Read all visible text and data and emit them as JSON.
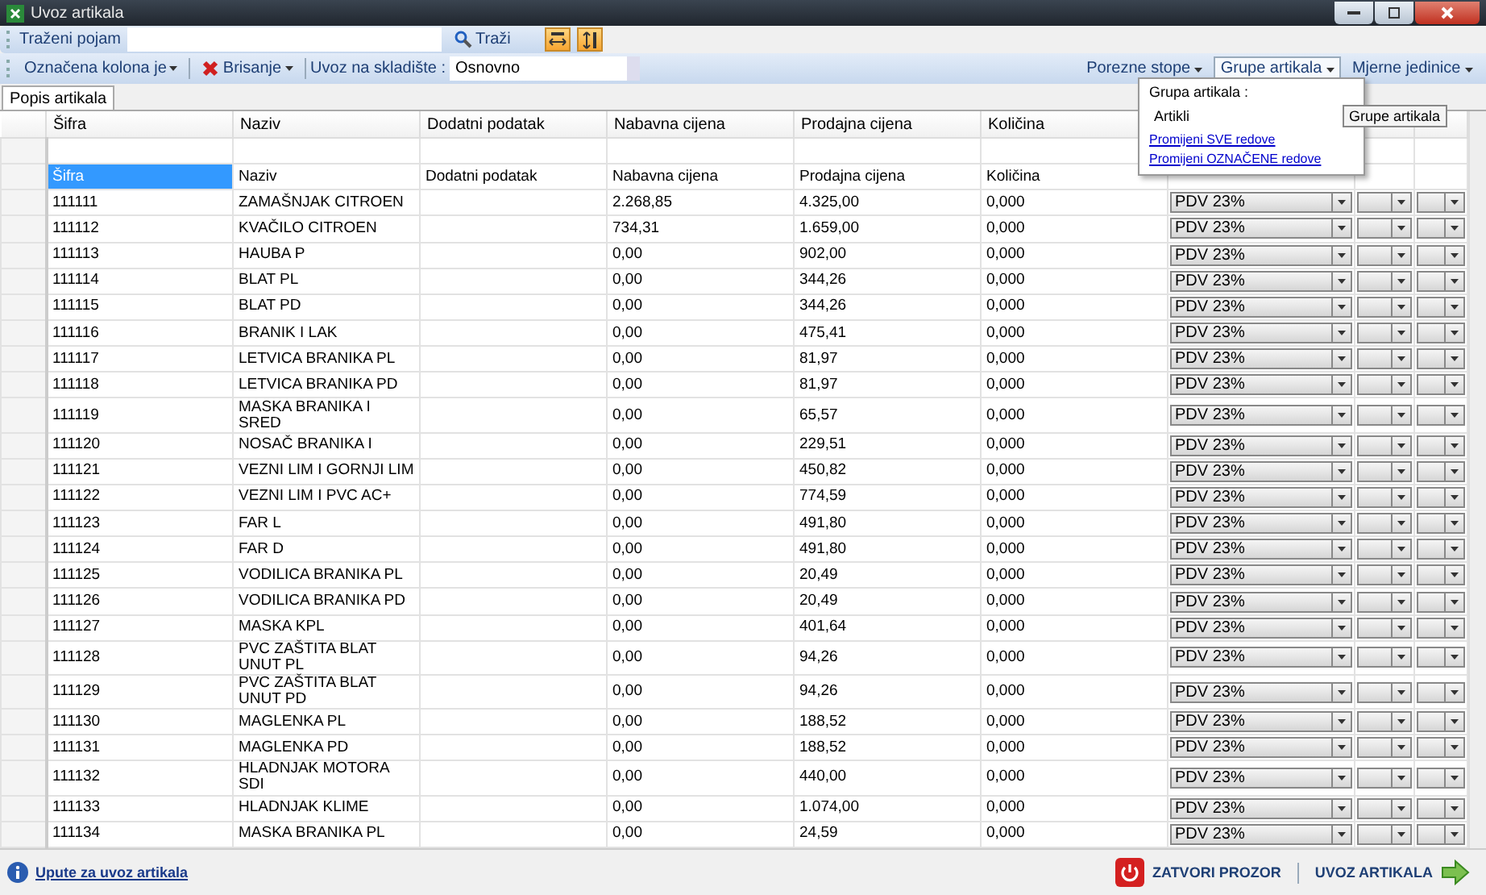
{
  "window": {
    "title": "Uvoz artikala"
  },
  "search_bar": {
    "label": "Traženi pojam",
    "search_button": "Traži"
  },
  "toolbar": {
    "marked_column": "Označena kolona je",
    "delete": "Brisanje",
    "warehouse_label": "Uvoz na skladište :",
    "warehouse_value": "Osnovno",
    "right_menus": [
      {
        "label": "Porezne stope",
        "selected": false
      },
      {
        "label": "Grupe artikala",
        "selected": true
      },
      {
        "label": "Mjerne jedinice",
        "selected": false
      }
    ]
  },
  "tabs": [
    {
      "label": "Popis artikala",
      "selected": true
    }
  ],
  "popup": {
    "label": "Grupa artikala :",
    "value": "Artikli",
    "links": [
      "Promijeni SVE redove",
      "Promijeni OZNAČENE redove"
    ],
    "tooltip": "Grupe artikala"
  },
  "table": {
    "columns": [
      "Šifra",
      "Naziv",
      "Dodatni podatak",
      "Nabavna cijena",
      "Prodajna cijena",
      "Količina"
    ],
    "header_row": [
      "Šifra",
      "Naziv",
      "Dodatni podatak",
      "Nabavna cijena",
      "Prodajna cijena",
      "Količina"
    ],
    "rows": [
      [
        "111111",
        "ZAMAŠNJAK CITROEN",
        "",
        "2.268,85",
        "4.325,00",
        "0,000",
        "PDV 23%"
      ],
      [
        "111112",
        "KVAČILO CITROEN",
        "",
        "734,31",
        "1.659,00",
        "0,000",
        "PDV 23%"
      ],
      [
        "111113",
        "HAUBA P",
        "",
        "0,00",
        "902,00",
        "0,000",
        "PDV 23%"
      ],
      [
        "111114",
        "BLAT PL",
        "",
        "0,00",
        "344,26",
        "0,000",
        "PDV 23%"
      ],
      [
        "111115",
        "BLAT PD",
        "",
        "0,00",
        "344,26",
        "0,000",
        "PDV 23%"
      ],
      [
        "111116",
        "BRANIK I LAK",
        "",
        "0,00",
        "475,41",
        "0,000",
        "PDV 23%"
      ],
      [
        "111117",
        "LETVICA BRANIKA PL",
        "",
        "0,00",
        "81,97",
        "0,000",
        "PDV 23%"
      ],
      [
        "111118",
        "LETVICA BRANIKA PD",
        "",
        "0,00",
        "81,97",
        "0,000",
        "PDV 23%"
      ],
      [
        "111119",
        "MASKA BRANIKA I SRED",
        "",
        "0,00",
        "65,57",
        "0,000",
        "PDV 23%"
      ],
      [
        "111120",
        "NOSAČ BRANIKA I",
        "",
        "0,00",
        "229,51",
        "0,000",
        "PDV 23%"
      ],
      [
        "111121",
        "VEZNI LIM I GORNJI LIM",
        "",
        "0,00",
        "450,82",
        "0,000",
        "PDV 23%"
      ],
      [
        "111122",
        "VEZNI LIM I PVC AC+",
        "",
        "0,00",
        "774,59",
        "0,000",
        "PDV 23%"
      ],
      [
        "111123",
        "FAR L",
        "",
        "0,00",
        "491,80",
        "0,000",
        "PDV 23%"
      ],
      [
        "111124",
        "FAR D",
        "",
        "0,00",
        "491,80",
        "0,000",
        "PDV 23%"
      ],
      [
        "111125",
        "VODILICA BRANIKA PL",
        "",
        "0,00",
        "20,49",
        "0,000",
        "PDV 23%"
      ],
      [
        "111126",
        "VODILICA BRANIKA PD",
        "",
        "0,00",
        "20,49",
        "0,000",
        "PDV 23%"
      ],
      [
        "111127",
        "MASKA KPL",
        "",
        "0,00",
        "401,64",
        "0,000",
        "PDV 23%"
      ],
      [
        "111128",
        "PVC ZAŠTITA BLAT UNUT PL",
        "",
        "0,00",
        "94,26",
        "0,000",
        "PDV 23%"
      ],
      [
        "111129",
        "PVC ZAŠTITA BLAT UNUT PD",
        "",
        "0,00",
        "94,26",
        "0,000",
        "PDV 23%"
      ],
      [
        "111130",
        "MAGLENKA PL",
        "",
        "0,00",
        "188,52",
        "0,000",
        "PDV 23%"
      ],
      [
        "111131",
        "MAGLENKA PD",
        "",
        "0,00",
        "188,52",
        "0,000",
        "PDV 23%"
      ],
      [
        "111132",
        "HLADNJAK MOTORA SDI",
        "",
        "0,00",
        "440,00",
        "0,000",
        "PDV 23%"
      ],
      [
        "111133",
        "HLADNJAK KLIME",
        "",
        "0,00",
        "1.074,00",
        "0,000",
        "PDV 23%"
      ],
      [
        "111134",
        "MASKA BRANIKA PL",
        "",
        "0,00",
        "24,59",
        "0,000",
        "PDV 23%"
      ]
    ]
  },
  "footer": {
    "help_link": "Upute za uvoz artikala",
    "close_button": "ZATVORI PROZOR",
    "import_button": "UVOZ ARTIKALA"
  }
}
